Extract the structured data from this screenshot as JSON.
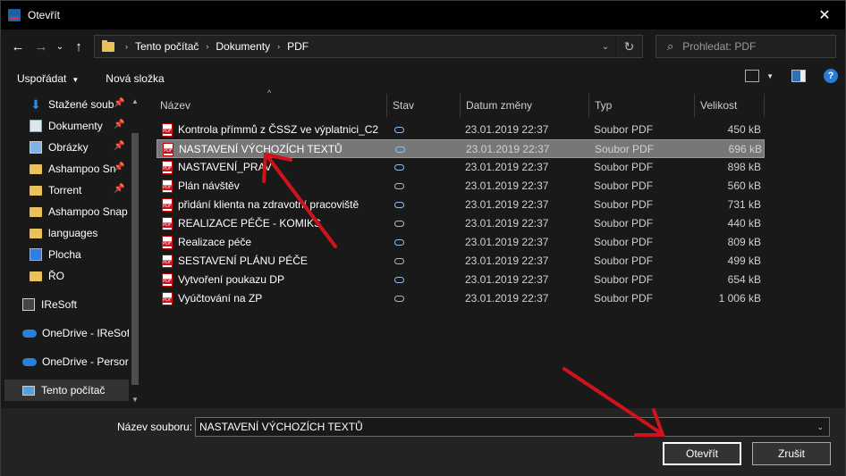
{
  "window": {
    "title": "Otevřít",
    "close": "✕"
  },
  "nav": {
    "back": "←",
    "forward": "→",
    "recent": "⌄",
    "up": "↑",
    "breadcrumb": [
      "Tento počítač",
      "Dokumenty",
      "PDF"
    ],
    "search_placeholder": "Prohledat: PDF"
  },
  "toolbar": {
    "organize": "Uspořádat",
    "new_folder": "Nová složka",
    "help": "?"
  },
  "sidebar": {
    "items": [
      {
        "label": "Stažené soub",
        "icon": "download-icon",
        "pinned": true
      },
      {
        "label": "Dokumenty",
        "icon": "document-icon",
        "pinned": true
      },
      {
        "label": "Obrázky",
        "icon": "pictures-icon",
        "pinned": true
      },
      {
        "label": "Ashampoo Sn",
        "icon": "folder-icon",
        "pinned": true
      },
      {
        "label": "Torrent",
        "icon": "folder-icon",
        "pinned": true
      },
      {
        "label": "Ashampoo Snap",
        "icon": "folder-icon",
        "pinned": false
      },
      {
        "label": "languages",
        "icon": "folder-icon",
        "pinned": false
      },
      {
        "label": "Plocha",
        "icon": "desktop-icon",
        "pinned": false
      },
      {
        "label": "ŘO",
        "icon": "folder-icon",
        "pinned": false
      },
      {
        "label": "IReSoft",
        "icon": "building-icon",
        "pinned": false
      },
      {
        "label": "OneDrive - IReSof",
        "icon": "cloud-icon",
        "pinned": false
      },
      {
        "label": "OneDrive - Persor",
        "icon": "cloud-icon",
        "pinned": false
      },
      {
        "label": "Tento počítač",
        "icon": "computer-icon",
        "pinned": false
      }
    ],
    "selected": "Tento počítač"
  },
  "columns": {
    "name": "Název",
    "status": "Stav",
    "date": "Datum změny",
    "type": "Typ",
    "size": "Velikost"
  },
  "files": [
    {
      "name": "Kontrola přímmů z ČSSZ ve výplatnici_C2",
      "date": "23.01.2019 22:37",
      "type": "Soubor PDF",
      "size": "450 kB"
    },
    {
      "name": "NASTAVENÍ VÝCHOZÍCH TEXTŮ",
      "date": "23.01.2019 22:37",
      "type": "Soubor PDF",
      "size": "696 kB"
    },
    {
      "name": "NASTAVENÍ_PRAV",
      "date": "23.01.2019 22:37",
      "type": "Soubor PDF",
      "size": "898 kB"
    },
    {
      "name": "Plán návštěv",
      "date": "23.01.2019 22:37",
      "type": "Soubor PDF",
      "size": "560 kB"
    },
    {
      "name": "přidání klienta na zdravotní pracoviště",
      "date": "23.01.2019 22:37",
      "type": "Soubor PDF",
      "size": "731 kB"
    },
    {
      "name": "REALIZACE PÉČE - KOMIKS",
      "date": "23.01.2019 22:37",
      "type": "Soubor PDF",
      "size": "440 kB"
    },
    {
      "name": "Realizace péče",
      "date": "23.01.2019 22:37",
      "type": "Soubor PDF",
      "size": "809 kB"
    },
    {
      "name": "SESTAVENÍ PLÁNU PÉČE",
      "date": "23.01.2019 22:37",
      "type": "Soubor PDF",
      "size": "499 kB"
    },
    {
      "name": "Vytvoření poukazu DP",
      "date": "23.01.2019 22:37",
      "type": "Soubor PDF",
      "size": "654 kB"
    },
    {
      "name": "Vyúčtování na ZP",
      "date": "23.01.2019 22:37",
      "type": "Soubor PDF",
      "size": "1 006 kB"
    }
  ],
  "selected_file": "NASTAVENÍ VÝCHOZÍCH TEXTŮ",
  "footer": {
    "filename_label": "Název souboru:",
    "filename_value": "NASTAVENÍ VÝCHOZÍCH TEXTŮ",
    "open_button": "Otevřít",
    "cancel_button": "Zrušit"
  },
  "colors": {
    "background": "#191919",
    "selection": "#777777",
    "annotation_arrow": "#d0131b",
    "accent": "#2a7bd3"
  }
}
